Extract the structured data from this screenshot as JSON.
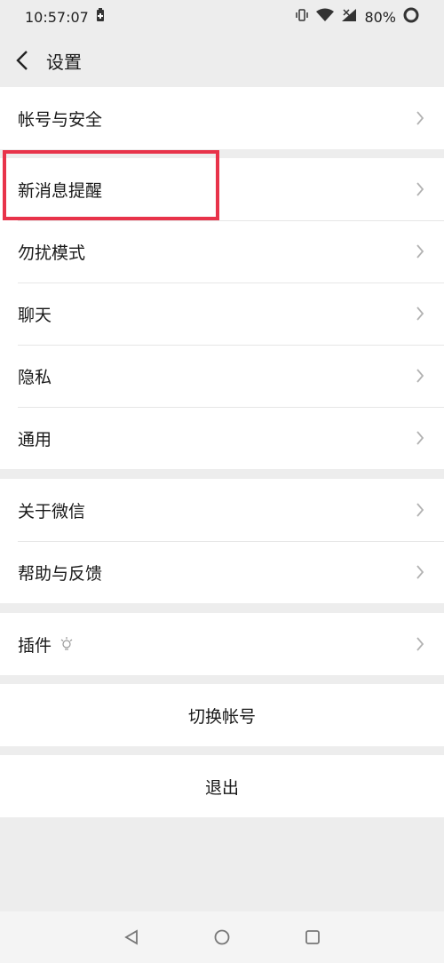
{
  "status_bar": {
    "time": "10:57:07",
    "battery": "80%"
  },
  "nav": {
    "title": "设置"
  },
  "groups": [
    {
      "items": [
        {
          "label": "帐号与安全"
        }
      ]
    },
    {
      "items": [
        {
          "label": "新消息提醒"
        },
        {
          "label": "勿扰模式"
        },
        {
          "label": "聊天"
        },
        {
          "label": "隐私"
        },
        {
          "label": "通用"
        }
      ]
    },
    {
      "items": [
        {
          "label": "关于微信"
        },
        {
          "label": "帮助与反馈"
        }
      ]
    },
    {
      "items": [
        {
          "label": "插件"
        }
      ]
    }
  ],
  "actions": {
    "switch_account": "切换帐号",
    "logout": "退出"
  },
  "colors": {
    "highlight": "#e8334a",
    "background": "#ededed"
  }
}
